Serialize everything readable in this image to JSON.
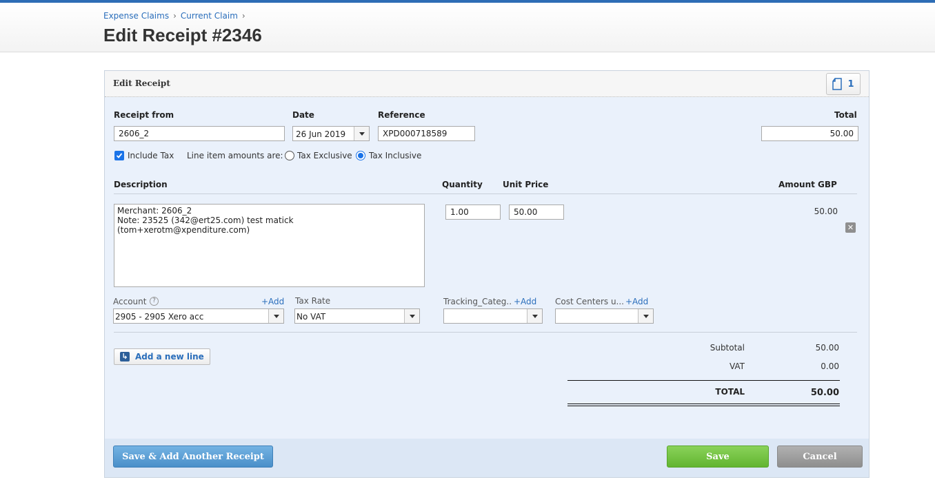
{
  "breadcrumb": {
    "items": [
      "Expense Claims",
      "Current Claim"
    ],
    "separator": "›"
  },
  "page": {
    "title": "Edit Receipt #2346"
  },
  "panel": {
    "title": "Edit Receipt",
    "attachments_count": "1"
  },
  "receipt": {
    "from_label": "Receipt from",
    "from_value": "2606_2",
    "date_label": "Date",
    "date_value": "26 Jun 2019",
    "reference_label": "Reference",
    "reference_value": "XPD000718589",
    "total_label": "Total",
    "total_value": "50.00"
  },
  "tax": {
    "include_label": "Include Tax",
    "include_checked": true,
    "line_amounts_label": "Line item amounts are:",
    "exclusive_label": "Tax Exclusive",
    "inclusive_label": "Tax Inclusive",
    "selected": "inclusive"
  },
  "columns": {
    "description": "Description",
    "quantity": "Quantity",
    "unit_price": "Unit Price",
    "amount": "Amount GBP"
  },
  "line_item": {
    "description": "Merchant: 2606_2\nNote: 23525 (342@ert25.com) test matick (tom+xerotm@xpenditure.com)",
    "quantity": "1.00",
    "unit_price": "50.00",
    "amount": "50.00",
    "account_label": "Account",
    "account_add": "+Add",
    "account_value": "2905 - 2905 Xero acc",
    "tax_rate_label": "Tax Rate",
    "tax_rate_value": "No VAT",
    "tracking_label": "Tracking_Categ..",
    "tracking_add": "+Add",
    "tracking_value": "",
    "cost_centers_label": "Cost Centers u...",
    "cost_centers_add": "+Add",
    "cost_centers_value": ""
  },
  "add_line_label": "Add a new line",
  "totals": {
    "subtotal_label": "Subtotal",
    "subtotal_value": "50.00",
    "vat_label": "VAT",
    "vat_value": "0.00",
    "total_label": "TOTAL",
    "total_value": "50.00"
  },
  "footer": {
    "save_add_label": "Save & Add Another Receipt",
    "save_label": "Save",
    "cancel_label": "Cancel"
  },
  "colors": {
    "accent": "#2d6db5",
    "link": "#2a6ebb",
    "save": "#62b530",
    "panel_bg": "#eaf1fb"
  }
}
